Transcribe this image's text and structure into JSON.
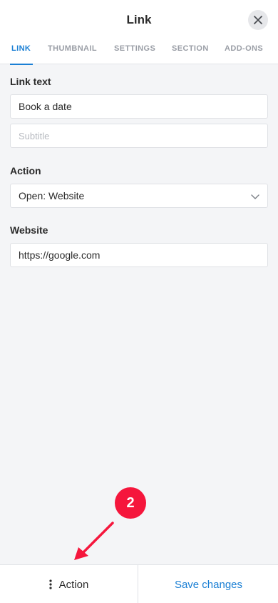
{
  "header": {
    "title": "Link",
    "tabs": [
      {
        "label": "LINK",
        "active": true
      },
      {
        "label": "THUMBNAIL",
        "active": false
      },
      {
        "label": "SETTINGS",
        "active": false
      },
      {
        "label": "SECTION",
        "active": false
      },
      {
        "label": "ADD-ONS",
        "active": false
      }
    ]
  },
  "form": {
    "link_text_label": "Link text",
    "link_text_value": "Book a date",
    "subtitle_placeholder": "Subtitle",
    "action_label": "Action",
    "action_value": "Open: Website",
    "website_label": "Website",
    "website_value": "https://google.com"
  },
  "annotation": {
    "badge": "2"
  },
  "footer": {
    "action_label": "Action",
    "save_label": "Save changes"
  },
  "colors": {
    "accent": "#1a7fd4",
    "badge": "#f5163c",
    "background": "#f4f5f7"
  }
}
